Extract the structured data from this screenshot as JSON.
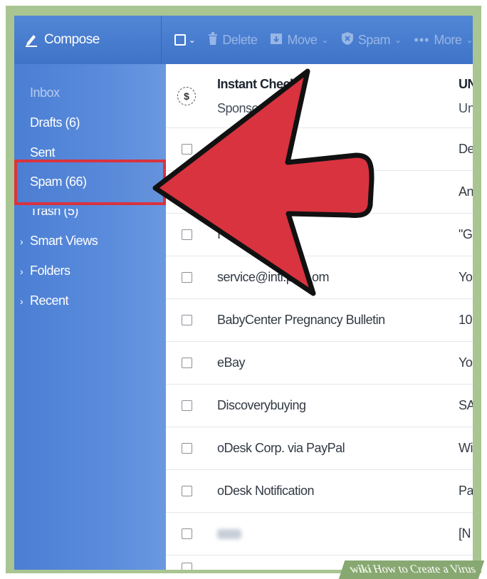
{
  "toolbar": {
    "compose_label": "Compose",
    "delete_label": "Delete",
    "move_label": "Move",
    "spam_label": "Spam",
    "more_label": "More"
  },
  "sidebar": {
    "items": [
      {
        "label": "Inbox"
      },
      {
        "label": "Drafts (6)"
      },
      {
        "label": "Sent"
      },
      {
        "label": "Spam (66)"
      },
      {
        "label": "Trash (5)"
      },
      {
        "label": "Smart Views"
      },
      {
        "label": "Folders"
      },
      {
        "label": "Recent"
      }
    ]
  },
  "messages": {
    "sponsored": {
      "sender": "Instant Check",
      "tag": "Sponso",
      "subject_line1": "UN",
      "subject_line2": "Un"
    },
    "rows": [
      {
        "sender": "",
        "subject": "De"
      },
      {
        "sender": "",
        "subject": "An"
      },
      {
        "sender": "I",
        "subject": "\"G"
      },
      {
        "sender": "service@intl.p",
        "sender_tail": "om",
        "subject": "Yo"
      },
      {
        "sender": "BabyCenter Pregnancy Bulletin",
        "subject": "10"
      },
      {
        "sender": "eBay",
        "subject": "Yo"
      },
      {
        "sender": "Discoverybuying",
        "subject": "SA"
      },
      {
        "sender": "oDesk Corp. via PayPal",
        "subject": "Wi"
      },
      {
        "sender": "oDesk Notification",
        "subject": "Pa"
      },
      {
        "sender": "",
        "subject": "[N"
      }
    ]
  },
  "watermark": {
    "brand": "wiki",
    "title": "How to Create a Virus"
  },
  "colors": {
    "toolbar_blue": "#4a7ecf",
    "sidebar_blue": "#5a8bdc",
    "arrow_red": "#d8333f",
    "frame_green": "#a9c592"
  }
}
